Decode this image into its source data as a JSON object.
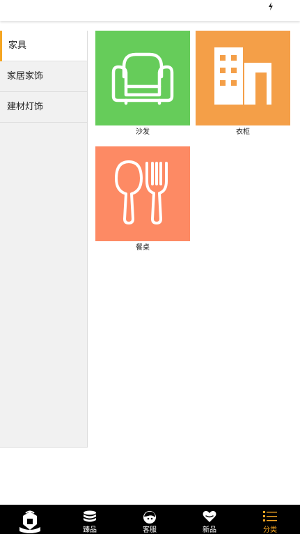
{
  "sidebar": {
    "items": [
      {
        "label": "家具",
        "active": true
      },
      {
        "label": "家居家饰",
        "active": false
      },
      {
        "label": "建材灯饰",
        "active": false
      }
    ]
  },
  "grid": {
    "tiles": [
      {
        "caption": "沙发",
        "icon": "sofa-icon",
        "color": "#66cc5a"
      },
      {
        "caption": "衣柜",
        "icon": "building-icon",
        "color": "#f49f48"
      },
      {
        "caption": "餐桌",
        "icon": "spoon-fork-icon",
        "color": "#fd8a64"
      }
    ]
  },
  "tabbar": {
    "items": [
      {
        "label": "",
        "icon": "brand-logo-icon"
      },
      {
        "label": "臻品",
        "icon": "coin-stack-icon"
      },
      {
        "label": "客服",
        "icon": "service-face-icon"
      },
      {
        "label": "新品",
        "icon": "heart-icon"
      },
      {
        "label": "分类",
        "icon": "list-icon"
      }
    ],
    "active_color": "#f5a623"
  },
  "colors": {
    "accent": "#f5a623",
    "sidebar_bg": "#f1f1f1",
    "tabbar_bg": "#000000"
  }
}
